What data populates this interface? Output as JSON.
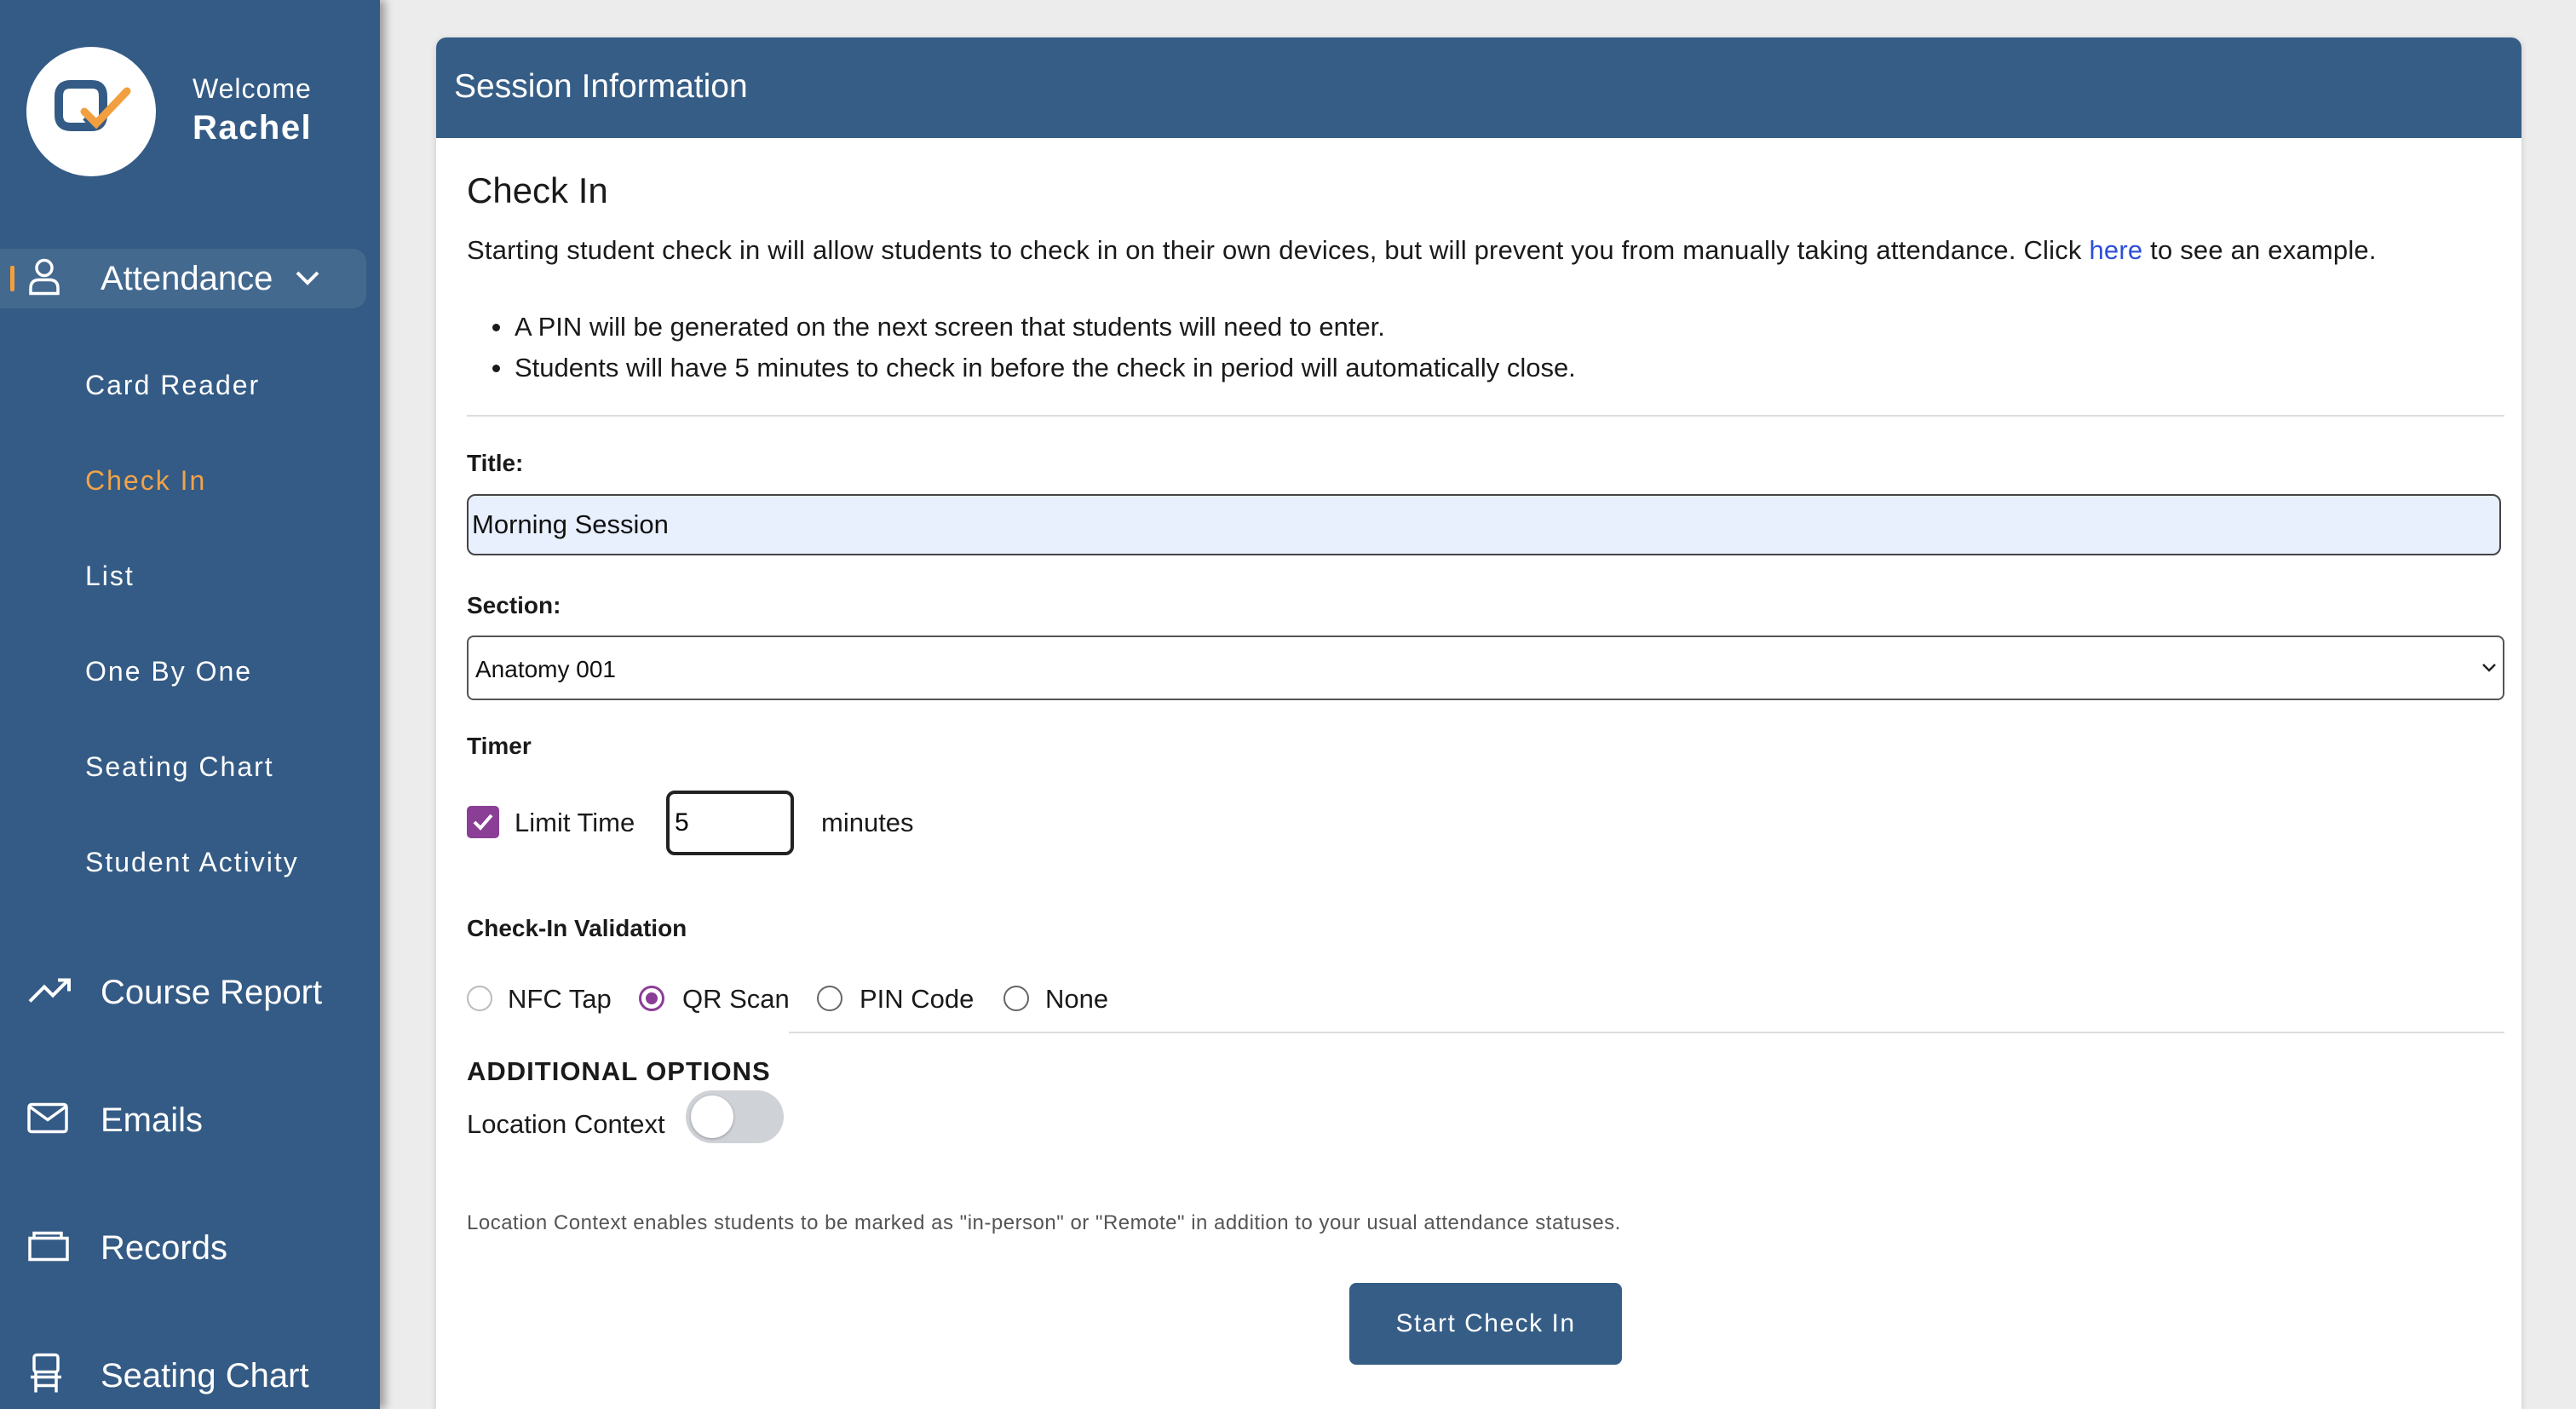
{
  "sidebar": {
    "welcome": "Welcome",
    "user_name": "Rachel",
    "attendance": {
      "label": "Attendance",
      "items": [
        "Card Reader",
        "Check In",
        "List",
        "One By One",
        "Seating Chart",
        "Student Activity"
      ],
      "active_item": "Check In"
    },
    "nav": [
      {
        "label": "Course Report",
        "icon": "trend-up-icon"
      },
      {
        "label": "Emails",
        "icon": "mail-icon"
      },
      {
        "label": "Records",
        "icon": "folder-icon"
      },
      {
        "label": "Seating Chart",
        "icon": "chair-icon"
      }
    ],
    "accent": "#f29f3f",
    "bg_color": "#345b85"
  },
  "card": {
    "header": "Session Information",
    "heading": "Check In",
    "intro_before": "Starting student check in will allow students to check in on their own devices, but will prevent you from manually taking attendance. Click ",
    "intro_link": "here",
    "intro_after": " to see an example.",
    "bullets": [
      "A PIN will be generated on the next screen that students will need to enter.",
      "Students will have 5 minutes to check in before the check in period will automatically close."
    ]
  },
  "form": {
    "title_label": "Title:",
    "title_value": "Morning Session",
    "section_label": "Section:",
    "section_value": "Anatomy 001",
    "timer_label": "Timer",
    "limit_time_label": "Limit Time",
    "limit_time_checked": true,
    "minutes_value": "5",
    "minutes_label": "minutes",
    "validation_label": "Check-In Validation",
    "validation_options": [
      "NFC Tap",
      "QR Scan",
      "PIN Code",
      "None"
    ],
    "validation_selected": "QR Scan",
    "additional_options": "ADDITIONAL OPTIONS",
    "location_context_label": "Location Context",
    "location_context_on": false,
    "location_help": "Location Context enables students to be marked as \"in-person\" or \"Remote\" in addition to your usual attendance statuses.",
    "start_button": "Start Check In"
  }
}
